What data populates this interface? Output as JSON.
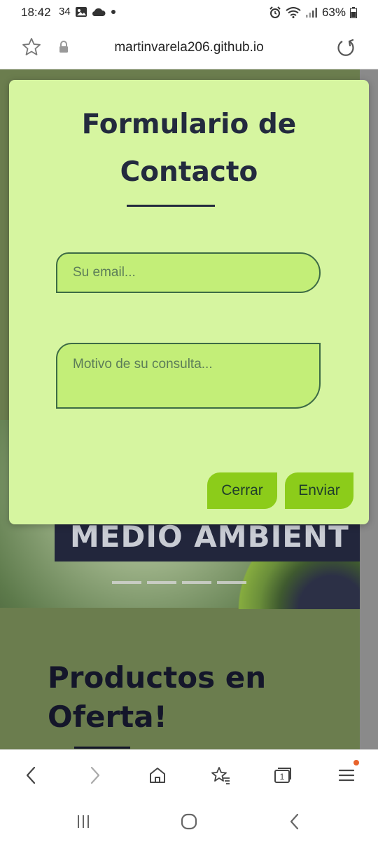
{
  "status_bar": {
    "time": "18:42",
    "extra": "34",
    "battery": "63%",
    "icons": [
      "image-icon",
      "cloud-icon",
      "dot-icon",
      "alarm-icon",
      "wifi-icon",
      "signal-icon",
      "battery-icon"
    ]
  },
  "browser": {
    "url": "martinvarela206.github.io",
    "icons": [
      "star-icon",
      "lock-icon",
      "reload-icon"
    ]
  },
  "background_page": {
    "banner_text": "MEDIO AMBIENT",
    "section_title_line1": "Productos en",
    "section_title_line2": "Oferta!"
  },
  "modal": {
    "title_line1": "Formulario de",
    "title_line2": "Contacto",
    "email_placeholder": "Su email...",
    "consult_placeholder": "Motivo de su consulta...",
    "close_label": "Cerrar",
    "send_label": "Enviar"
  },
  "toolbar": {
    "tabs_count": "1",
    "icons": [
      "back-icon",
      "forward-icon",
      "home-icon",
      "bookmarks-icon",
      "tabs-icon",
      "menu-icon"
    ]
  },
  "colors": {
    "modal_bg": "#d6f5a0",
    "field_bg": "#c3ee78",
    "button_bg": "#8ccc1a",
    "title_text": "#232a3e",
    "page_bg": "#6b7d4e"
  }
}
